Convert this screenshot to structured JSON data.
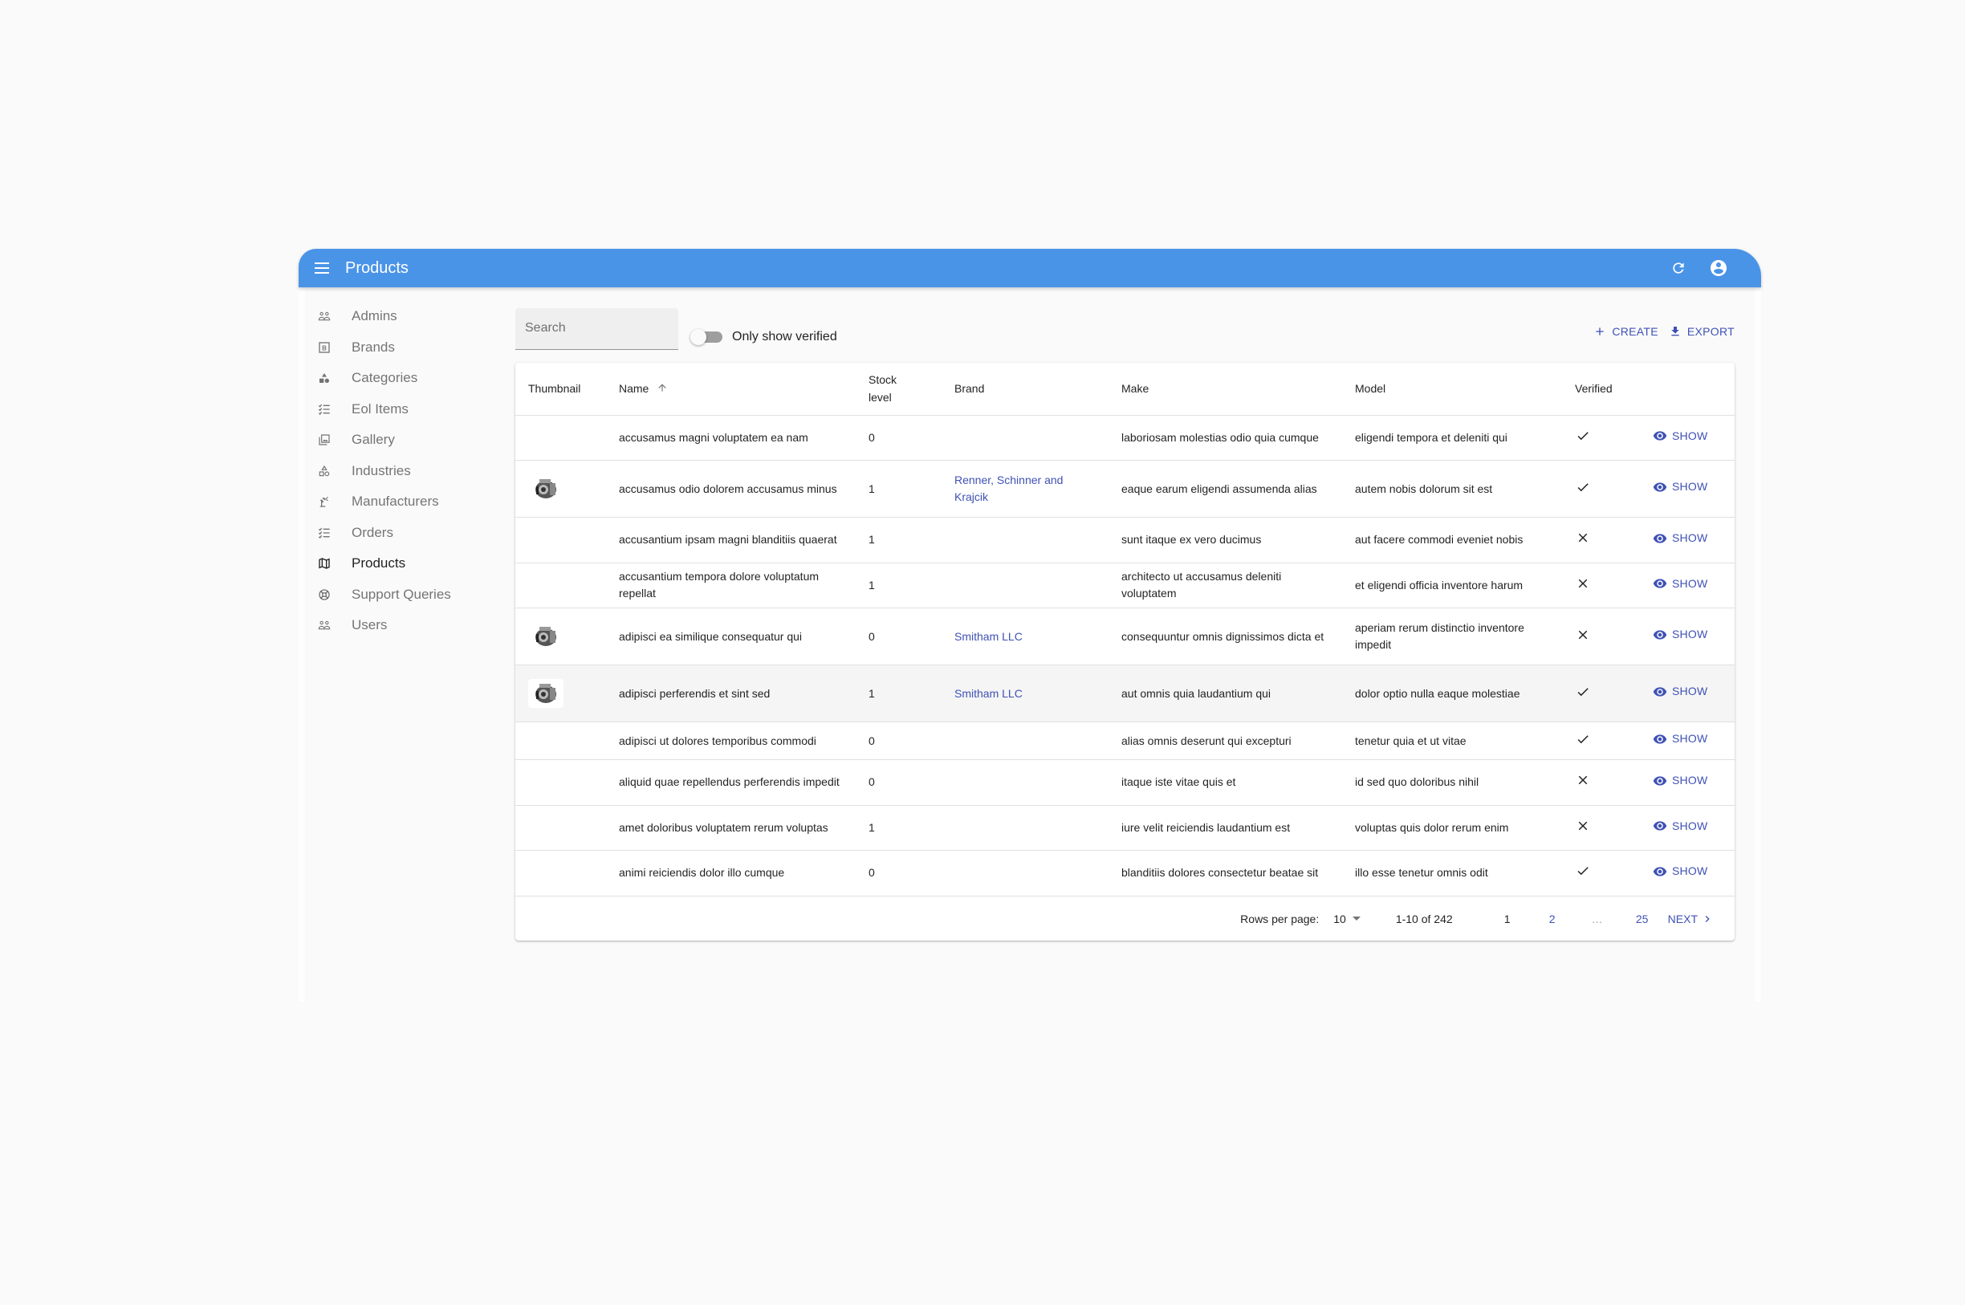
{
  "app": {
    "title": "Products",
    "accent_color": "#4a94e8",
    "link_color": "#3f51b5"
  },
  "sidebar": {
    "items": [
      {
        "label": "Admins",
        "icon": "people-icon",
        "active": false
      },
      {
        "label": "Brands",
        "icon": "brand-b-icon",
        "active": false
      },
      {
        "label": "Categories",
        "icon": "category-shapes-icon",
        "active": false
      },
      {
        "label": "Eol Items",
        "icon": "checklist-icon",
        "active": false
      },
      {
        "label": "Gallery",
        "icon": "photo-library-icon",
        "active": false
      },
      {
        "label": "Industries",
        "icon": "category-outline-icon",
        "active": false
      },
      {
        "label": "Manufacturers",
        "icon": "precision-manufacturing-icon",
        "active": false
      },
      {
        "label": "Orders",
        "icon": "checklist-icon",
        "active": false
      },
      {
        "label": "Products",
        "icon": "book-map-icon",
        "active": true
      },
      {
        "label": "Support Queries",
        "icon": "lifebuoy-icon",
        "active": false
      },
      {
        "label": "Users",
        "icon": "people-icon",
        "active": false
      }
    ]
  },
  "toolbar": {
    "search_placeholder": "Search",
    "search_value": "",
    "toggle_label": "Only show verified",
    "toggle_on": false,
    "create_label": "CREATE",
    "export_label": "EXPORT"
  },
  "table": {
    "columns": {
      "thumbnail": "Thumbnail",
      "name": "Name",
      "stock_line1": "Stock",
      "stock_line2": "level",
      "brand": "Brand",
      "make": "Make",
      "model": "Model",
      "verified": "Verified"
    },
    "sort": {
      "column": "Name",
      "direction": "ascending"
    },
    "show_label": "SHOW",
    "rows": [
      {
        "thumbnail": false,
        "name": "accusamus magni voluptatem ea nam",
        "stock": "0",
        "brand": "",
        "make": "laboriosam molestias odio quia cumque",
        "model": "eligendi tempora et deleniti qui",
        "verified": true
      },
      {
        "thumbnail": true,
        "name": "accusamus odio dolorem accusamus minus",
        "stock": "1",
        "brand": "Renner, Schinner and Krajcik",
        "make": "eaque earum eligendi assumenda alias",
        "model": "autem nobis dolorum sit est",
        "verified": true
      },
      {
        "thumbnail": false,
        "name": "accusantium ipsam magni blanditiis quaerat",
        "stock": "1",
        "brand": "",
        "make": "sunt itaque ex vero ducimus",
        "model": "aut facere commodi eveniet nobis",
        "verified": false
      },
      {
        "thumbnail": false,
        "name": "accusantium tempora dolore voluptatum repellat",
        "stock": "1",
        "brand": "",
        "make": "architecto ut accusamus deleniti voluptatem",
        "model": "et eligendi officia inventore harum",
        "verified": false
      },
      {
        "thumbnail": true,
        "name": "adipisci ea similique consequatur qui",
        "stock": "0",
        "brand": "Smitham LLC",
        "make": "consequuntur omnis dignissimos dicta et",
        "model": "aperiam rerum distinctio inventore impedit",
        "verified": false
      },
      {
        "thumbnail": true,
        "name": "adipisci perferendis et sint sed",
        "stock": "1",
        "brand": "Smitham LLC",
        "make": "aut omnis quia laudantium qui",
        "model": "dolor optio nulla eaque molestiae",
        "verified": true
      },
      {
        "thumbnail": false,
        "name": "adipisci ut dolores temporibus commodi",
        "stock": "0",
        "brand": "",
        "make": "alias omnis deserunt qui excepturi",
        "model": "tenetur quia et ut vitae",
        "verified": true
      },
      {
        "thumbnail": false,
        "name": "aliquid quae repellendus perferendis impedit",
        "stock": "0",
        "brand": "",
        "make": "itaque iste vitae quis et",
        "model": "id sed quo doloribus nihil",
        "verified": false
      },
      {
        "thumbnail": false,
        "name": "amet doloribus voluptatem rerum voluptas",
        "stock": "1",
        "brand": "",
        "make": "iure velit reiciendis laudantium est",
        "model": "voluptas quis dolor rerum enim",
        "verified": false
      },
      {
        "thumbnail": false,
        "name": "animi reiciendis dolor illo cumque",
        "stock": "0",
        "brand": "",
        "make": "blanditiis dolores consectetur beatae sit",
        "model": "illo esse tenetur omnis odit",
        "verified": true
      }
    ]
  },
  "pagination": {
    "rows_per_page_label": "Rows per page:",
    "rows_per_page": "10",
    "range": "1-10 of 242",
    "pages": [
      "1",
      "2",
      "…",
      "25"
    ],
    "current_page": "1",
    "next_label": "NEXT"
  }
}
